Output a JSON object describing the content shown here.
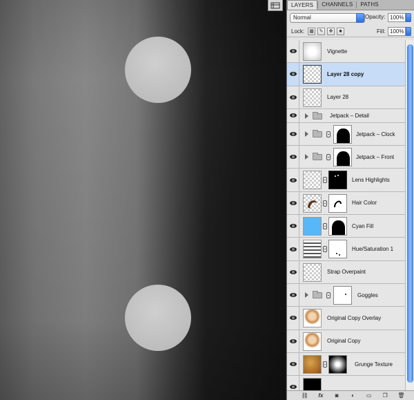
{
  "panel": {
    "tabs": [
      "LAYERS",
      "CHANNELS",
      "PATHS"
    ],
    "active_tab": "LAYERS",
    "blend_mode": "Normal",
    "opacity_label": "Opacity:",
    "opacity_value": "100%",
    "lock_label": "Lock:",
    "fill_label": "Fill:",
    "fill_value": "100%",
    "layers": [
      {
        "name": "Vignette",
        "selected": false
      },
      {
        "name": "Layer 28 copy",
        "selected": true
      },
      {
        "name": "Layer 28",
        "selected": false
      },
      {
        "name": "Jetpack – Detail",
        "selected": false
      },
      {
        "name": "Jetpack – Clock",
        "selected": false
      },
      {
        "name": "Jetpack – Front",
        "selected": false
      },
      {
        "name": "Lens Highlights",
        "selected": false
      },
      {
        "name": "Hair Color",
        "selected": false
      },
      {
        "name": "Cyan Fill",
        "selected": false
      },
      {
        "name": "Hue/Saturation 1",
        "selected": false
      },
      {
        "name": "Strap Overpaint",
        "selected": false
      },
      {
        "name": "Goggles",
        "selected": false
      },
      {
        "name": "Original Copy Overlay",
        "selected": false
      },
      {
        "name": "Original Copy",
        "selected": false
      },
      {
        "name": "Grunge Texture",
        "selected": false
      },
      {
        "name": "",
        "selected": false
      }
    ],
    "bottom_icons": [
      "link-icon",
      "fx-icon",
      "mask-icon",
      "adjustment-icon",
      "folder-icon",
      "new-layer-icon",
      "trash-icon"
    ],
    "accent": "#c7dcf7",
    "cyan_fill_color": "#57b7f7"
  },
  "canvas": {
    "dot_color": "#c4c4c4"
  }
}
